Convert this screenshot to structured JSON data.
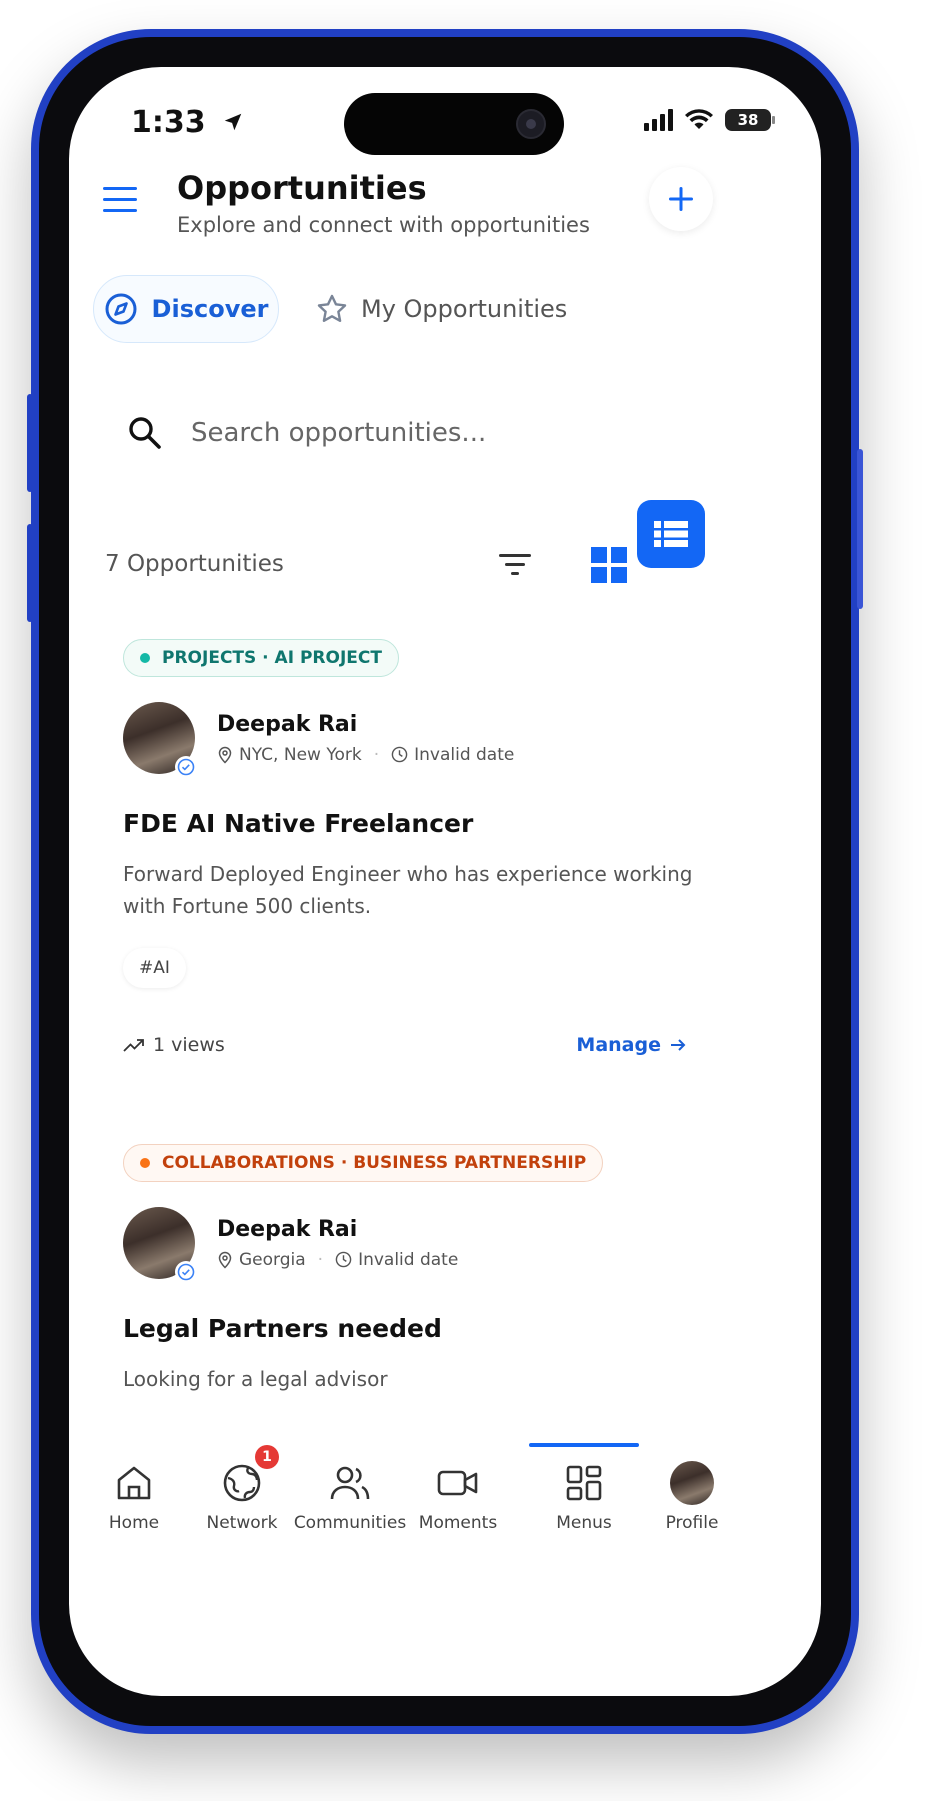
{
  "status_bar": {
    "time": "1:33",
    "battery": "38"
  },
  "header": {
    "title": "Opportunities",
    "subtitle": "Explore and connect with opportunities"
  },
  "tabs": [
    {
      "label": "Discover",
      "active": true
    },
    {
      "label": "My Opportunities",
      "active": false
    }
  ],
  "search": {
    "placeholder": "Search opportunities..."
  },
  "results": {
    "count_label": "7 Opportunities",
    "view_mode": "list"
  },
  "cards": [
    {
      "category": "PROJECTS · AI PROJECT",
      "author": "Deepak Rai",
      "location": "NYC, New York",
      "date": "Invalid date",
      "title": "FDE AI Native Freelancer",
      "description": "Forward Deployed Engineer who has experience working with Fortune 500 clients.",
      "tag": "#AI",
      "views": "1 views",
      "action": "Manage"
    },
    {
      "category": "COLLABORATIONS · BUSINESS PARTNERSHIP",
      "author": "Deepak Rai",
      "location": "Georgia",
      "date": "Invalid date",
      "title": "Legal Partners needed",
      "description": "Looking for a legal advisor"
    }
  ],
  "bottom_nav": [
    {
      "label": "Home",
      "icon": "home-icon"
    },
    {
      "label": "Network",
      "icon": "globe-icon",
      "badge": "1"
    },
    {
      "label": "Communities",
      "icon": "people-icon"
    },
    {
      "label": "Moments",
      "icon": "video-icon"
    },
    {
      "label": "Menus",
      "icon": "grid-icon",
      "active": true
    },
    {
      "label": "Profile",
      "icon": "avatar"
    }
  ],
  "colors": {
    "accent": "#1367f5",
    "phone_frame": "#2140c4",
    "chip_green": "#0f766e",
    "chip_orange": "#c2410c",
    "badge": "#e53935"
  }
}
